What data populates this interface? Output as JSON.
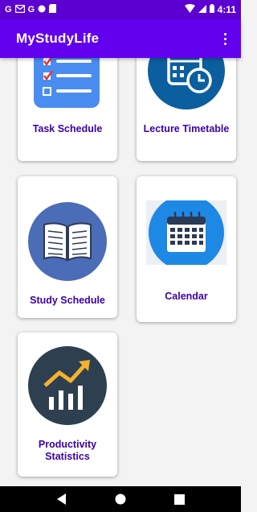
{
  "status_bar": {
    "left_icons": [
      "G",
      "mail-icon",
      "G",
      "circle-icon",
      "sd-card-icon"
    ],
    "time": "4:11"
  },
  "app_bar": {
    "title": "MyStudyLife"
  },
  "cards": [
    {
      "id": "task-schedule",
      "label": "Task Schedule",
      "icon": "checklist-icon"
    },
    {
      "id": "lecture-timetable",
      "label": "Lecture Timetable",
      "icon": "calendar-clock-icon"
    },
    {
      "id": "study-schedule",
      "label": "Study Schedule",
      "icon": "open-book-icon"
    },
    {
      "id": "calendar",
      "label": "Calendar",
      "icon": "calendar-icon"
    },
    {
      "id": "productivity-statistics",
      "label": "Productivity Statistics",
      "icon": "bar-chart-trend-icon"
    }
  ],
  "colors": {
    "status_bar": "#5c00d2",
    "app_bar": "#6200ee",
    "card_label": "#3a00a8"
  }
}
